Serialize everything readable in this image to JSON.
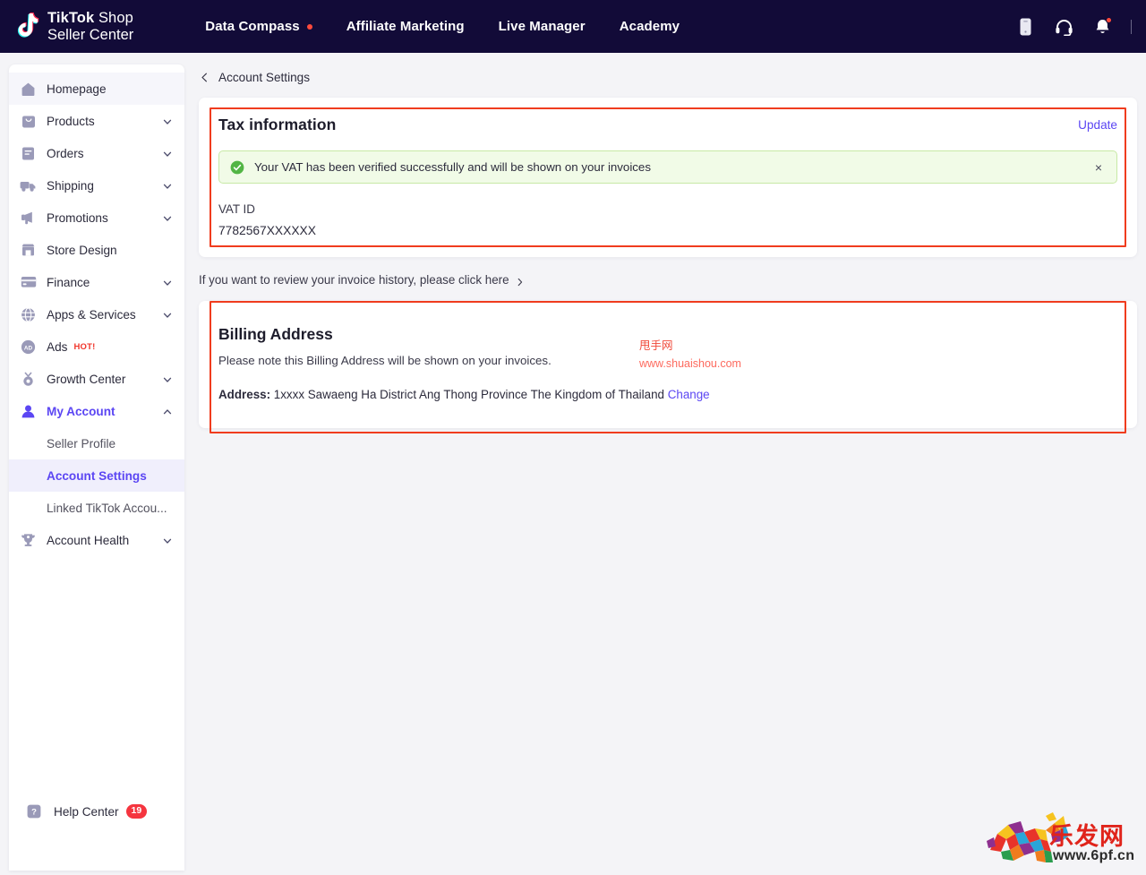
{
  "topnav": {
    "brand_bold": "TikTok",
    "brand_shop": " Shop",
    "brand_line2": "Seller Center",
    "items": [
      {
        "label": "Data Compass",
        "dot": true
      },
      {
        "label": "Affiliate Marketing",
        "dot": false
      },
      {
        "label": "Live Manager",
        "dot": false
      },
      {
        "label": "Academy",
        "dot": false
      }
    ],
    "icons": [
      "mobile-icon",
      "headset-icon",
      "bell-icon"
    ]
  },
  "sidebar": {
    "items": [
      {
        "label": "Homepage",
        "icon": "home-icon",
        "chevron": false,
        "state": "soft"
      },
      {
        "label": "Products",
        "icon": "bag-icon",
        "chevron": true,
        "state": ""
      },
      {
        "label": "Orders",
        "icon": "orders-icon",
        "chevron": true,
        "state": ""
      },
      {
        "label": "Shipping",
        "icon": "truck-icon",
        "chevron": true,
        "state": ""
      },
      {
        "label": "Promotions",
        "icon": "megaphone-icon",
        "chevron": true,
        "state": ""
      },
      {
        "label": "Store Design",
        "icon": "store-icon",
        "chevron": false,
        "state": ""
      },
      {
        "label": "Finance",
        "icon": "card-icon",
        "chevron": true,
        "state": ""
      },
      {
        "label": "Apps & Services",
        "icon": "globe-icon",
        "chevron": true,
        "state": ""
      },
      {
        "label": "Ads",
        "icon": "ads-icon",
        "chevron": false,
        "state": "",
        "badge": "HOT!"
      },
      {
        "label": "Growth Center",
        "icon": "medal-icon",
        "chevron": true,
        "state": ""
      },
      {
        "label": "My Account",
        "icon": "user-icon",
        "chevron": true,
        "chevron_up": true,
        "state": "purple"
      }
    ],
    "subitems": [
      {
        "label": "Seller Profile",
        "active": false
      },
      {
        "label": "Account Settings",
        "active": true
      },
      {
        "label": "Linked TikTok Accou...",
        "active": false
      }
    ],
    "after_sub": [
      {
        "label": "Account Health",
        "icon": "trophy-icon",
        "chevron": true,
        "state": ""
      }
    ],
    "help": {
      "label": "Help Center",
      "badge": "19",
      "icon": "question-icon"
    }
  },
  "breadcrumb": {
    "label": "Account Settings",
    "icon": "back-chevron-icon"
  },
  "tax_card": {
    "title": "Tax information",
    "update_label": "Update",
    "alert": {
      "text": "Your VAT has been verified successfully and will be shown on your invoices",
      "icon": "check-circle-icon",
      "close": "×"
    },
    "vat_label": "VAT ID",
    "vat_value": "7782567XXXXXX"
  },
  "invoice_line": {
    "text": "If you want to review your invoice history, please click here",
    "icon": "chevron-right-icon"
  },
  "billing_card": {
    "title": "Billing Address",
    "note": "Please note this Billing Address will be shown on your invoices.",
    "address_label": "Address:",
    "address_value": "1xxxx Sawaeng Ha District Ang Thong Province The Kingdom of Thailand",
    "change_label": "Change"
  },
  "watermarks": {
    "main_cn": "甩手网",
    "main_url": "www.shuaishou.com",
    "logo_cn": "乐发网",
    "logo_url": "www.6pf.cn"
  },
  "colors": {
    "nav_bg": "#120b38",
    "accent_purple": "#5b46f3",
    "alert_bg": "#f1fbe7",
    "alert_border": "#c7e9a5",
    "annotation_red": "#f03c1e",
    "badge_red": "#f5353f"
  }
}
